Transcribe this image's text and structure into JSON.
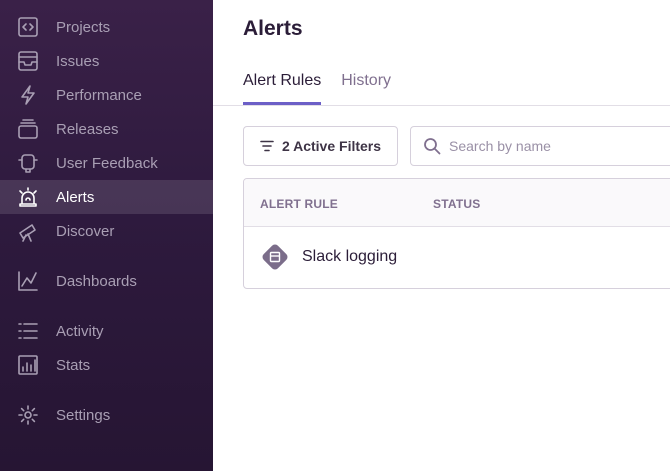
{
  "sidebar": {
    "items": [
      {
        "label": "Projects",
        "icon": "projects-icon",
        "active": false
      },
      {
        "label": "Issues",
        "icon": "issues-icon",
        "active": false
      },
      {
        "label": "Performance",
        "icon": "lightning-icon",
        "active": false
      },
      {
        "label": "Releases",
        "icon": "releases-icon",
        "active": false
      },
      {
        "label": "User Feedback",
        "icon": "megaphone-icon",
        "active": false
      },
      {
        "label": "Alerts",
        "icon": "siren-icon",
        "active": true
      },
      {
        "label": "Discover",
        "icon": "telescope-icon",
        "active": false
      },
      {
        "label": "Dashboards",
        "icon": "graph-icon",
        "active": false
      },
      {
        "label": "Activity",
        "icon": "list-icon",
        "active": false
      },
      {
        "label": "Stats",
        "icon": "bar-chart-icon",
        "active": false
      },
      {
        "label": "Settings",
        "icon": "gear-icon",
        "active": false
      }
    ]
  },
  "main": {
    "title": "Alerts",
    "tabs": [
      {
        "label": "Alert Rules",
        "active": true
      },
      {
        "label": "History",
        "active": false
      }
    ],
    "filter_button_label": "2 Active Filters",
    "search": {
      "placeholder": "Search by name",
      "value": ""
    },
    "table": {
      "columns": [
        "ALERT RULE",
        "STATUS"
      ],
      "rows": [
        {
          "name": "Slack logging",
          "icon": "issue-alert-icon",
          "status": ""
        }
      ]
    }
  },
  "colors": {
    "sidebar_bg": "#2e1a3e",
    "accent": "#6c5fc7",
    "text_primary": "#2b1d38",
    "text_muted": "#80708f"
  }
}
